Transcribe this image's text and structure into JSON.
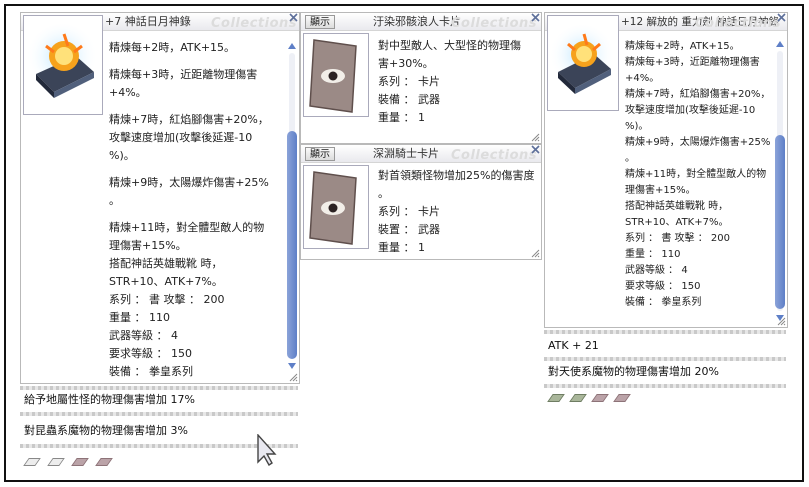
{
  "left_window": {
    "title": "+7 神話日月神錄",
    "watermark": "Collections",
    "lines": [
      "精煉每+2時，ATK+15。",
      "精煉每+3時，近距離物理傷害",
      "+4%。",
      "精煉+7時，紅焰腳傷害+20%，",
      "攻擊速度增加(攻擊後延遲-10",
      "%)。",
      "精煉+9時，太陽爆炸傷害+25%",
      "。",
      "精煉+11時，對全體型敵人的物",
      "理傷害+15%。",
      "搭配神話英雄戰靴 時，",
      "STR+10、ATK+7%。",
      "系列 ： 書 攻擊 ： 200",
      "重量 ： 110",
      "武器等級 ： 4",
      "要求等級 ： 150",
      "裝備 ： 拳皇系列"
    ],
    "options": [
      "給予地屬性怪的物理傷害增加 17%",
      "對昆蟲系魔物的物理傷害增加  3%"
    ],
    "slots": [
      "empty",
      "empty",
      "filled",
      "filled"
    ]
  },
  "card1": {
    "button": "顯示",
    "title": "汙染邪骸浪人卡片",
    "watermark": "Collections",
    "lines": [
      "對中型敵人、大型怪的物理傷",
      "害+30%。",
      "",
      "系列 ： 卡片",
      "裝備 ： 武器",
      "重量 ： 1"
    ]
  },
  "card2": {
    "button": "顯示",
    "title": "深淵騎士卡片",
    "watermark": "Collections",
    "lines": [
      "對首領類怪物增加25%的傷害度",
      "。",
      "系列 ： 卡片",
      "裝置 ： 武器",
      "重量 ： 1"
    ]
  },
  "right_window": {
    "title": "+12 解放的 重力劍 神話日月神錄",
    "watermark": "Collections",
    "lines": [
      "精煉每+2時，ATK+15。",
      "精煉每+3時，近距離物理傷害",
      "+4%。",
      "精煉+7時，紅焰腳傷害+20%，",
      "攻擊速度增加(攻擊後延遲-10",
      "%)。",
      "精煉+9時，太陽爆炸傷害+25%",
      "。",
      "精煉+11時，對全體型敵人的物",
      "理傷害+15%。",
      "搭配神話英雄戰靴 時，",
      "STR+10、ATK+7%。",
      "系列 ： 書 攻擊 ： 200",
      "重量 ： 110",
      "武器等級 ： 4",
      "要求等級 ： 150",
      "裝備 ： 拳皇系列"
    ],
    "options": [
      "ATK + 21",
      "對天使系魔物的物理傷害增加  20%"
    ],
    "slots": [
      "green",
      "green",
      "filled",
      "filled"
    ]
  },
  "colors": {
    "scroll_thumb": "#6f8dd0",
    "slot_filled": "#bba3a8"
  }
}
